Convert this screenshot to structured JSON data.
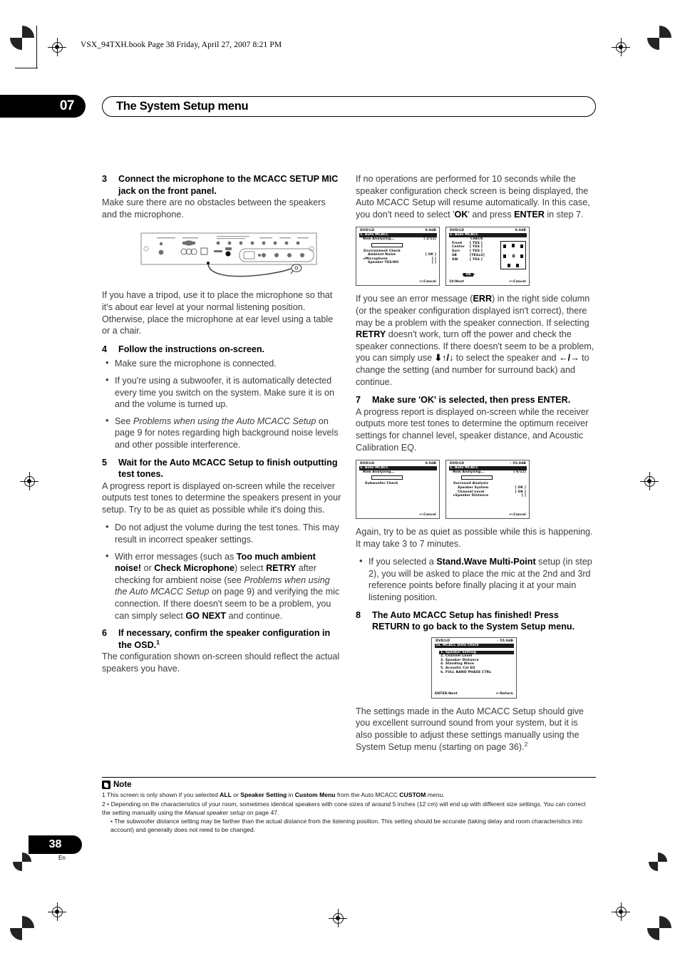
{
  "running_head": "VSX_94TXH.book  Page 38  Friday, April 27, 2007  8:21 PM",
  "chapter": {
    "number": "07",
    "title": "The System Setup menu"
  },
  "page_number": {
    "value": "38",
    "lang": "En"
  },
  "left_column": {
    "step3": {
      "num": "3",
      "heading": "Connect the microphone to the MCACC SETUP MIC jack on the front panel.",
      "body": "Make sure there are no obstacles between the speakers and the microphone."
    },
    "tripod_para": "If you have a tripod, use it to place the microphone so that it's about ear level at your normal listening position. Otherwise, place the microphone at ear level using a table or a chair.",
    "step4": {
      "num": "4",
      "heading": "Follow the instructions on-screen.",
      "bullets": [
        "Make sure the microphone is connected.",
        "If you're using a subwoofer, it is automatically detected every time you switch on the system. Make sure it is on and the volume is turned up.",
        "See Problems when using the Auto MCACC Setup on page 9 for notes regarding high background noise levels and other possible interference."
      ]
    },
    "step5": {
      "num": "5",
      "heading": "Wait for the Auto MCACC Setup to finish outputting test tones.",
      "body": "A progress report is displayed on-screen while the receiver outputs test tones to determine the speakers present in your setup. Try to be as quiet as possible while it's doing this.",
      "bullets": [
        "Do not adjust the volume during the test tones. This may result in incorrect speaker settings.",
        "With error messages (such as Too much ambient noise! or Check Microphone) select RETRY after checking for ambient noise (see Problems when using the Auto MCACC Setup on page 9) and verifying the mic connection. If there doesn't seem to be a problem, you can simply select GO NEXT and continue."
      ]
    },
    "step6": {
      "num": "6",
      "heading": "If necessary, confirm the speaker configuration in the OSD.",
      "heading_sup": "1",
      "body": "The configuration shown on-screen should reflect the actual speakers you have."
    }
  },
  "right_column": {
    "timeout_para": "If no operations are performed for 10 seconds while the speaker configuration check screen is being displayed, the Auto MCACC Setup will resume automatically. In this case, you don't need to select 'OK' and press ENTER in step 7.",
    "error_para": "If you see an error message (ERR) in the right side column (or the speaker configuration displayed isn't correct), there may be a problem with the speaker connection. If selecting RETRY doesn't work, turn off the power and check the speaker connections. If there doesn't seem to be a problem, you can simply use ↑/↓ to select the speaker and ←/→ to change the setting (and number for surround back) and continue.",
    "step7": {
      "num": "7",
      "heading": "Make sure 'OK' is selected, then press ENTER.",
      "body": "A progress report is displayed on-screen while the receiver outputs more test tones to determine the optimum receiver settings for channel level, speaker distance, and Acoustic Calibration EQ."
    },
    "quiet_para": "Again, try to be as quiet as possible while this is happening. It may take 3 to 7 minutes.",
    "quiet_bullet": "If you selected a Stand.Wave Multi-Point setup (in step 2), you will be asked to place the mic at the 2nd and 3rd reference points before finally placing it at your main listening position.",
    "step8": {
      "num": "8",
      "heading": "The Auto MCACC Setup has finished! Press RETURN to go back to the System Setup menu."
    },
    "final_para": "The settings made in the Auto MCACC Setup should give you excellent surround sound from your system, but it is also possible to adjust these settings manually using the System Setup menu (starting on page 36).",
    "final_sup": "2"
  },
  "osd_screens": {
    "env_check": {
      "source": "DVD/LD",
      "level": "0.0dB",
      "title": "1. Auto MCACC",
      "status": "Now Analyzing…",
      "progress": "( 2/11)",
      "section": "Environment Check",
      "rows": [
        {
          "label": "Ambient Noise",
          "value": "[ OK ]",
          "cursor": false
        },
        {
          "label": "Microphone",
          "value": "[     ]",
          "cursor": true
        },
        {
          "label": "Speaker YES/NO",
          "value": "[     ]",
          "cursor": false
        }
      ],
      "footer_right": "↵:Cancel"
    },
    "spk_check": {
      "source": "DVD/LD",
      "level": "0.0dB",
      "title": "1. Auto MCACC",
      "col_header": "CHECK",
      "rows": [
        {
          "label": "Front",
          "value": "[ YES ]"
        },
        {
          "label": "Center",
          "value": "[ YES ]"
        },
        {
          "label": "Surr",
          "value": "[ YES ]"
        },
        {
          "label": "SB",
          "value": "[YESx2]"
        },
        {
          "label": "SW",
          "value": "[ YES ]"
        }
      ],
      "ok_button": "OK",
      "footer_left": "10:Next",
      "footer_right": "↵:Cancel"
    },
    "sub_check": {
      "source": "DVD/LD",
      "level": "0.0dB",
      "title": "1. Auto MCACC",
      "status": "Now Analyzing…",
      "section": "Subwoofer Check",
      "footer_right": "↵:Cancel"
    },
    "surr_analysis": {
      "source": "DVD/LD",
      "level": "– 55.0dB",
      "title": "1. Auto MCACC",
      "status": "Now  Analyzing…",
      "progress": "( 6/11)",
      "section": "Surround Analysis",
      "rows": [
        {
          "label": "Speaker System",
          "value": "[ OK ]",
          "cursor": false
        },
        {
          "label": "Channel Level",
          "value": "[ OK ]",
          "cursor": false
        },
        {
          "label": "Speaker Distance",
          "value": "[     ]",
          "cursor": true
        }
      ],
      "footer_right": "↵:Cancel"
    },
    "data_check": {
      "source": "DVD/LD",
      "level": "– 55.0dB",
      "title": "5a. MCACC Data Check",
      "items": [
        "1. Speaker Setting",
        "2. Channel Level",
        "3. Speaker Distance",
        "4. Standing Wave",
        "5. Acoustic Cal EQ",
        "6. FULL BAND PHASE CTRL"
      ],
      "selected_index": 0,
      "footer_left": "ENTER:Next",
      "footer_right": "↵:Return"
    }
  },
  "notes": {
    "title": "Note",
    "items": [
      "1 This screen is only shown if you selected ALL or Speaker Setting in Custom Menu from the Auto MCACC CUSTOM menu.",
      "2 • Depending on the characteristics of your room, sometimes identical speakers with cone sizes of around 5 inches (12 cm) will end up with different size settings. You can correct the setting manually using the Manual speaker setup on page 47.",
      "• The subwoofer distance setting may be farther than the actual distance from the listening position. This setting should be accurate (taking delay and room characteristics into account) and generally does not need to be changed."
    ]
  }
}
